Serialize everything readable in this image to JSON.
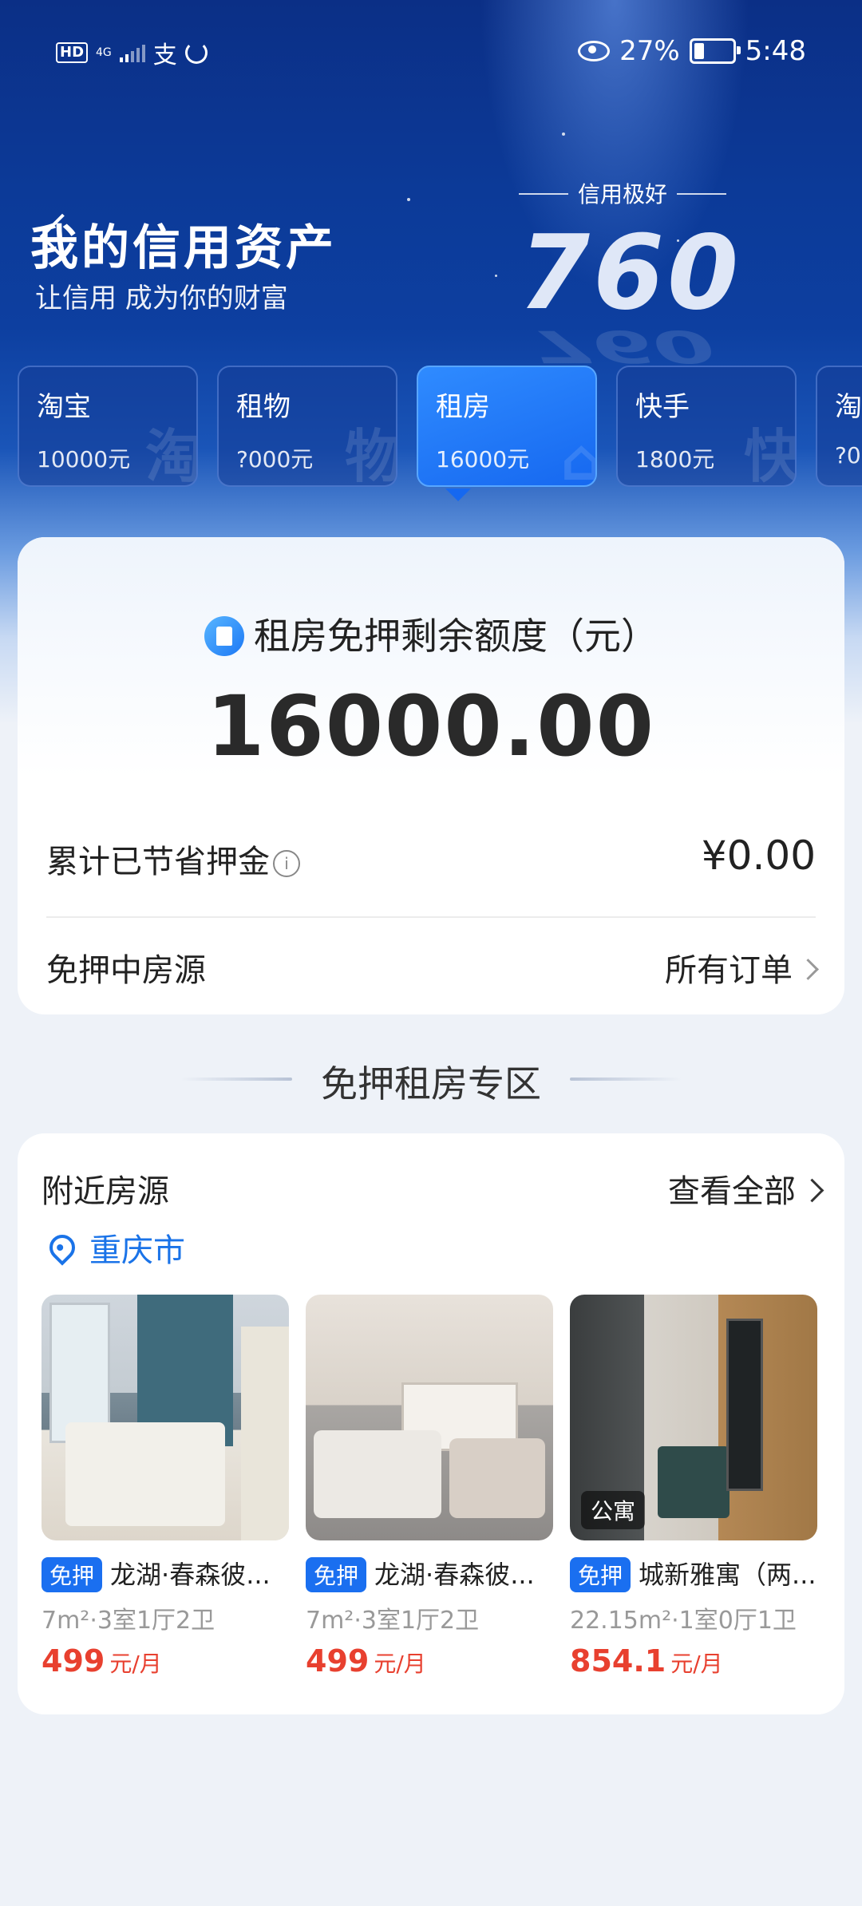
{
  "status_bar": {
    "left_hd": "HD",
    "left_signal": "4G",
    "left_app": "支",
    "battery": "27%",
    "time": "5:48"
  },
  "header": {
    "title": "我的信用资产",
    "subtitle": "让信用 成为你的财富",
    "credit_level": "信用极好",
    "credit_score": "760"
  },
  "categories": [
    {
      "name": "淘宝",
      "amount": "10000元",
      "watermark": "淘",
      "active": false
    },
    {
      "name": "租物",
      "amount": "?000元",
      "watermark": "物",
      "active": false
    },
    {
      "name": "租房",
      "amount": "16000元",
      "watermark": "⌂",
      "active": true
    },
    {
      "name": "快手",
      "amount": "1800元",
      "watermark": "快",
      "active": false
    },
    {
      "name": "淘",
      "amount": "?0",
      "watermark": "",
      "active": false
    }
  ],
  "quota": {
    "title": "租房免押剩余额度（元）",
    "amount": "16000.00",
    "saved_label": "累计已节省押金",
    "saved_value": "¥0.00",
    "listing_label": "免押中房源",
    "orders_link": "所有订单"
  },
  "section_title": "免押租房专区",
  "nearby": {
    "title": "附近房源",
    "view_all": "查看全部",
    "location": "重庆市",
    "houses": [
      {
        "badge": "免押",
        "name": "龙湖·春森彼...",
        "spec": "7m²·3室1厅2卫",
        "price": "499",
        "unit": "元/月",
        "tag": ""
      },
      {
        "badge": "免押",
        "name": "龙湖·春森彼...",
        "spec": "7m²·3室1厅2卫",
        "price": "499",
        "unit": "元/月",
        "tag": ""
      },
      {
        "badge": "免押",
        "name": "城新雅寓（两...",
        "spec": "22.15m²·1室0厅1卫",
        "price": "854.1",
        "unit": "元/月",
        "tag": "公寓"
      }
    ]
  },
  "colors": {
    "brand_blue": "#1a6ff0",
    "price_red": "#e8402f",
    "hero_dark": "#0b2f86"
  }
}
